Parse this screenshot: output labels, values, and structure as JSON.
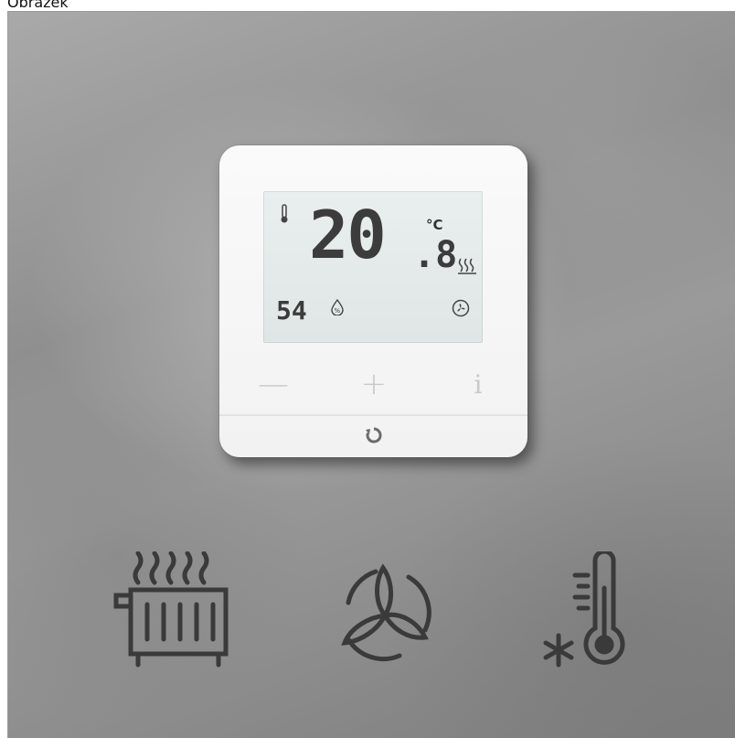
{
  "caption": "Obrázek",
  "thermostat": {
    "temperature_integer": "20",
    "temperature_decimal": ".8",
    "unit": "°C",
    "humidity": "54",
    "buttons": {
      "minus": "—",
      "plus": "+",
      "info": "i"
    }
  },
  "icons": {
    "radiator": "radiator-heating-icon",
    "fan": "fan-icon",
    "cooling": "thermometer-snowflake-icon"
  },
  "colors": {
    "lcd_background": "#e3eaea",
    "lcd_segments": "#3c3c3c",
    "device_body": "#f5f5f5",
    "icon_stroke": "#3a3a3a"
  }
}
